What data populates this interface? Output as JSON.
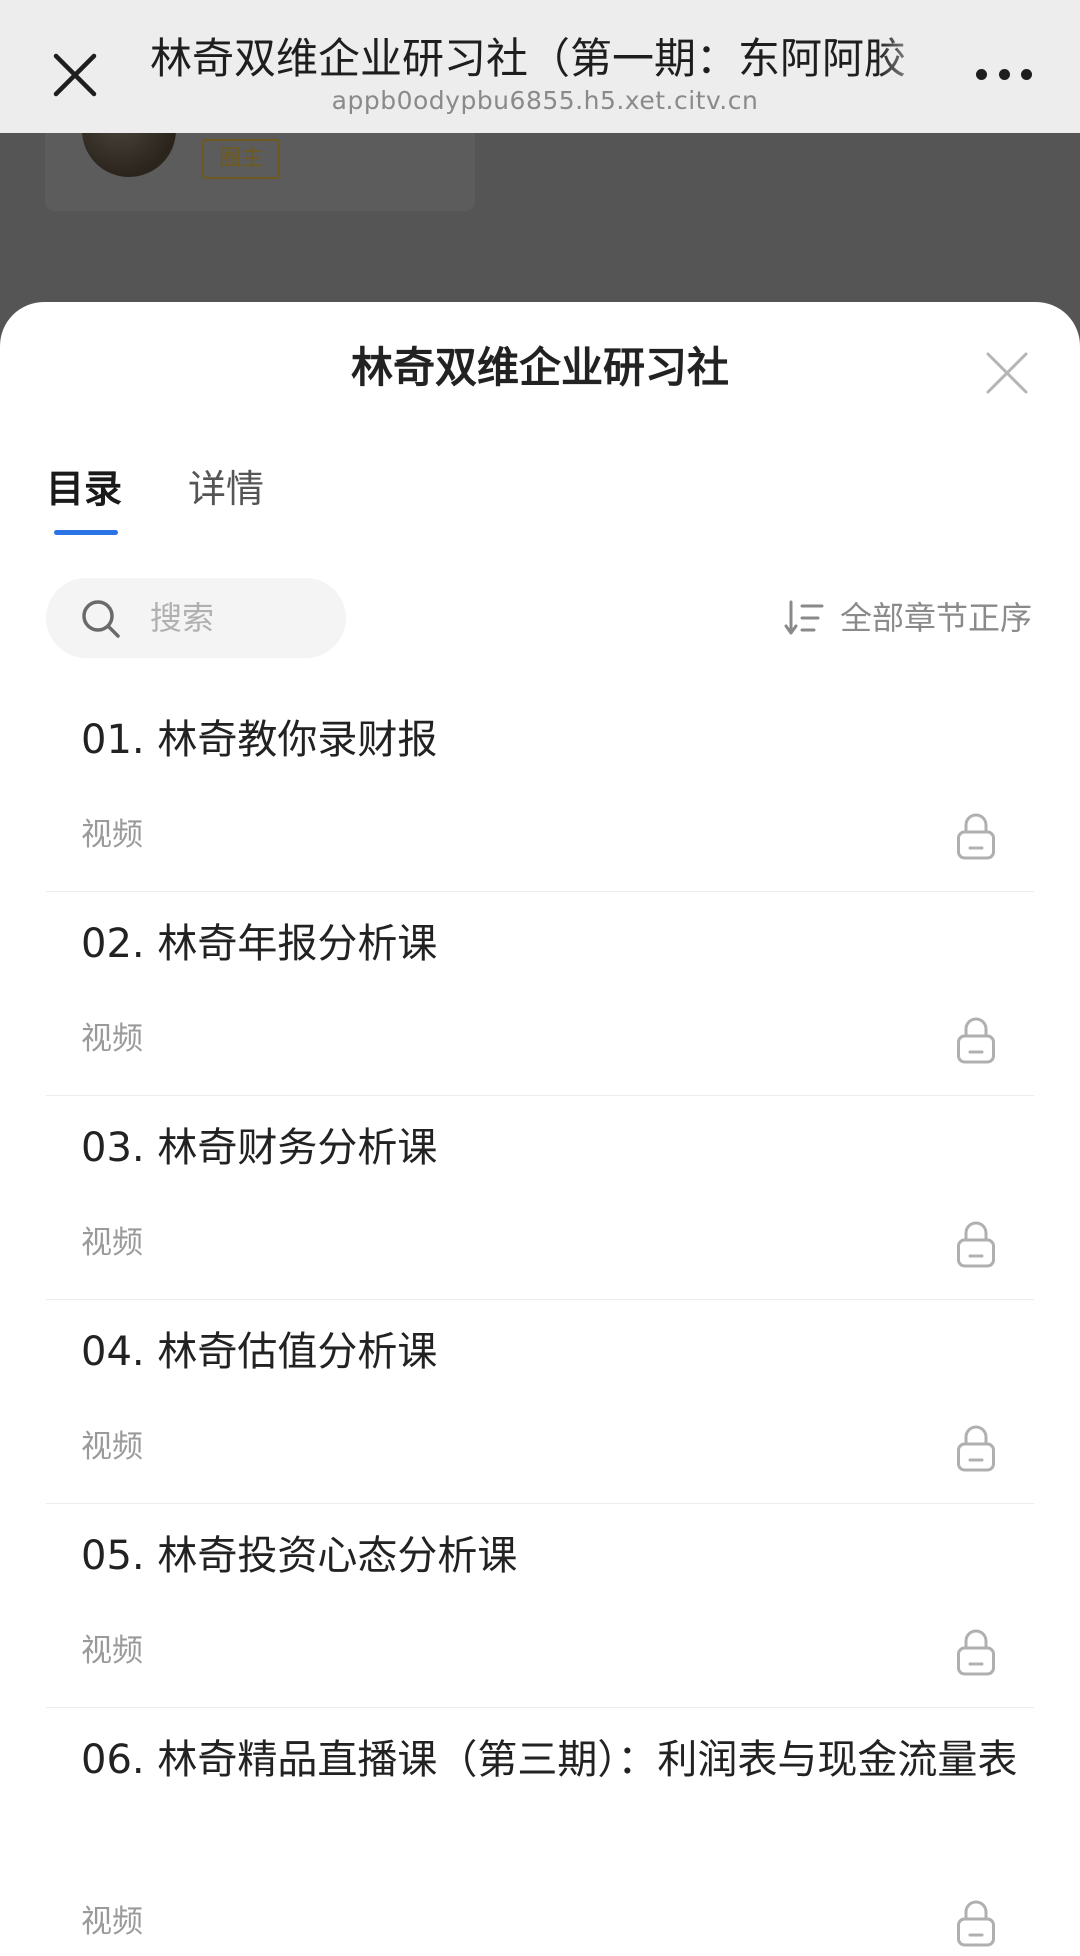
{
  "browser": {
    "title": "林奇双维企业研习社（第一期：东阿阿胶",
    "url": "appb0odypbu6855.h5.xet.citv.cn",
    "close_icon": "close-icon",
    "more_icon": "more-icon"
  },
  "background_page": {
    "badge": "圈主"
  },
  "sheet": {
    "title": "林奇双维企业研习社",
    "tabs": [
      {
        "label": "目录",
        "active": true
      },
      {
        "label": "详情",
        "active": false
      }
    ],
    "search": {
      "placeholder": "搜索",
      "icon": "search-icon"
    },
    "sort": {
      "label": "全部章节正序",
      "icon": "sort-icon"
    },
    "items": [
      {
        "title": "01. 林奇教你录财报",
        "type": "视频",
        "locked": true
      },
      {
        "title": "02. 林奇年报分析课",
        "type": "视频",
        "locked": true
      },
      {
        "title": "03. 林奇财务分析课",
        "type": "视频",
        "locked": true
      },
      {
        "title": "04. 林奇估值分析课",
        "type": "视频",
        "locked": true
      },
      {
        "title": "05. 林奇投资心态分析课",
        "type": "视频",
        "locked": true
      },
      {
        "title": "06. 林奇精品直播课（第三期）：利润表与现金流量表",
        "type": "视频",
        "locked": true
      }
    ]
  },
  "colors": {
    "accent": "#2b74e6",
    "text_primary": "#222222",
    "text_secondary": "#9a9a9a",
    "overlay": "#555555"
  }
}
